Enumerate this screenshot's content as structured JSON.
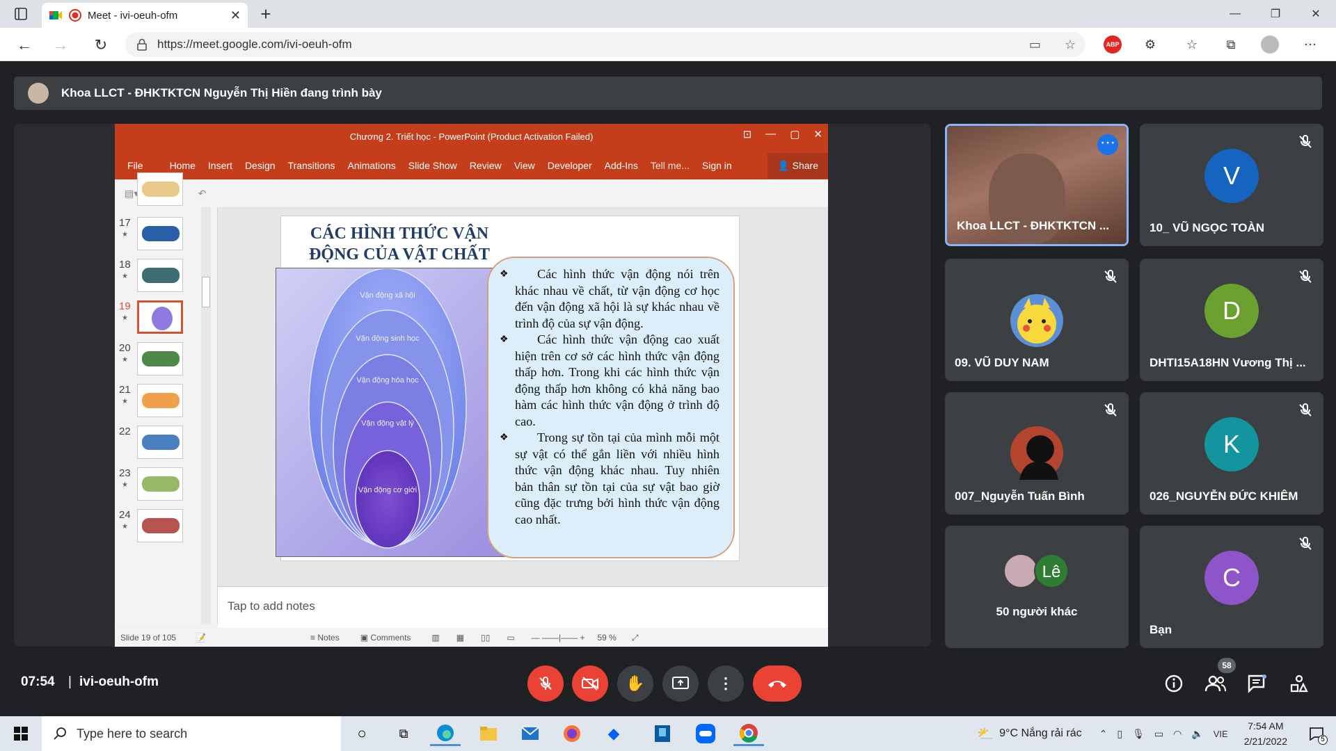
{
  "browser": {
    "tab_title": "Meet - ivi-oeuh-ofm",
    "url": "https://meet.google.com/ivi-oeuh-ofm",
    "new_tab": "+",
    "abp_label": "ABP"
  },
  "meet": {
    "presenter_banner": "Khoa LLCT - ĐHKTKTCN Nguyễn Thị Hiền đang trình bày",
    "clock": "07:54",
    "separator": "|",
    "meeting_code": "ivi-oeuh-ofm",
    "participant_count": "58",
    "tiles": [
      {
        "name": "Khoa LLCT - ĐHKTKTCN ...",
        "letter": "",
        "color": ""
      },
      {
        "name": "10_ VŨ NGỌC TOÀN",
        "letter": "V",
        "color": "#1565c0"
      },
      {
        "name": "09. VŨ DUY NAM",
        "letter": "",
        "color": ""
      },
      {
        "name": "DHTI15A18HN Vương Thị ...",
        "letter": "D",
        "color": "#6aa12f"
      },
      {
        "name": "007_Nguyễn Tuấn Bình",
        "letter": "",
        "color": ""
      },
      {
        "name": "026_NGUYỄN ĐỨC KHIÊM",
        "letter": "K",
        "color": "#12959e"
      },
      {
        "name": "50 người khác",
        "letter": "Lê",
        "color": "#2e7d32"
      },
      {
        "name": "Bạn",
        "letter": "C",
        "color": "#8e54c9"
      }
    ]
  },
  "ppt": {
    "window_title": "Chương  2. Triết học - PowerPoint (Product Activation Failed)",
    "ribbon_tabs": [
      "File",
      "Home",
      "Insert",
      "Design",
      "Transitions",
      "Animations",
      "Slide Show",
      "Review",
      "View",
      "Developer",
      "Add-Ins",
      "Tell me...",
      "Sign in"
    ],
    "share_label": "Share",
    "thumb_numbers": [
      "17",
      "18",
      "19",
      "20",
      "21",
      "22",
      "23",
      "24"
    ],
    "slide_title": "CÁC HÌNH THỨC VẬN ĐỘNG CỦA VẬT CHẤT",
    "nested_labels": [
      "Vận động xã hội",
      "Vận động sinh học",
      "Vận động hóa học",
      "Vận động vật lý",
      "Vận động cơ giới"
    ],
    "paragraphs": [
      "Các hình thức vận động nói trên khác nhau về chất, từ vận động cơ học đến vận động xã hội là sự khác nhau về trình độ của sự vận động.",
      "Các hình thức vận động cao xuất hiện trên cơ sở các hình thức vận động thấp hơn. Trong khi các hình thức vận động thấp hơn không có khả năng bao hàm các hình thức vận động ở trình độ cao.",
      "Trong sự tồn tại của mình mỗi một sự vật có thể gắn liền với nhiều hình thức vận động khác nhau. Tuy nhiên bản thân sự tồn tại của sự vật bao giờ cũng đặc trưng bởi hình thức vận động cao nhất."
    ],
    "notes_placeholder": "Tap to add notes",
    "status_slide": "Slide 19 of 105",
    "status_notes": "Notes",
    "status_comments": "Comments",
    "zoom": "59 %"
  },
  "taskbar": {
    "search_placeholder": "Type here to search",
    "weather": "9°C  Nắng rải rác",
    "lang": "VIE",
    "time": "7:54 AM",
    "date": "2/21/2022",
    "notif_count": "5"
  }
}
